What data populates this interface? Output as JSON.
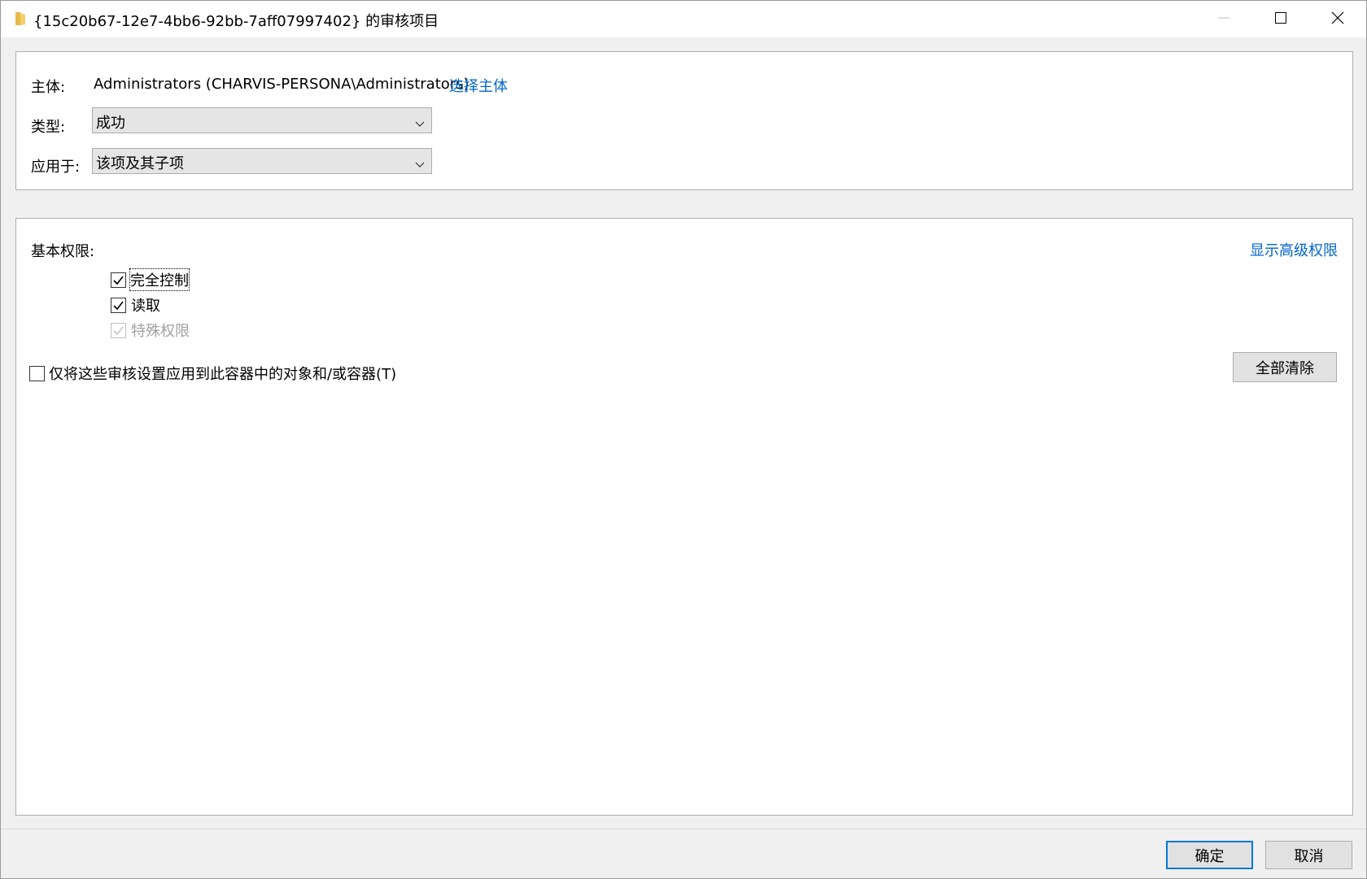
{
  "window": {
    "title": "{15c20b67-12e7-4bb6-92bb-7aff07997402} 的审核项目",
    "icon": "folder-icon"
  },
  "principal": {
    "label": "主体:",
    "value": "Administrators (CHARVIS-PERSONA\\Administrators)",
    "select_link": "选择主体"
  },
  "type": {
    "label": "类型:",
    "value": "成功"
  },
  "applies_to": {
    "label": "应用于:",
    "value": "该项及其子项"
  },
  "permissions": {
    "heading": "基本权限:",
    "advanced_link": "显示高级权限",
    "items": [
      {
        "label": "完全控制",
        "checked": true,
        "enabled": true
      },
      {
        "label": "读取",
        "checked": true,
        "enabled": true
      },
      {
        "label": "特殊权限",
        "checked": true,
        "enabled": false
      }
    ],
    "apply_only_label": "仅将这些审核设置应用到此容器中的对象和/或容器(T)",
    "apply_only_checked": false,
    "clear_all_label": "全部清除"
  },
  "footer": {
    "ok_label": "确定",
    "cancel_label": "取消"
  },
  "colors": {
    "link": "#0066cc",
    "default_button_border": "#0078d7"
  }
}
